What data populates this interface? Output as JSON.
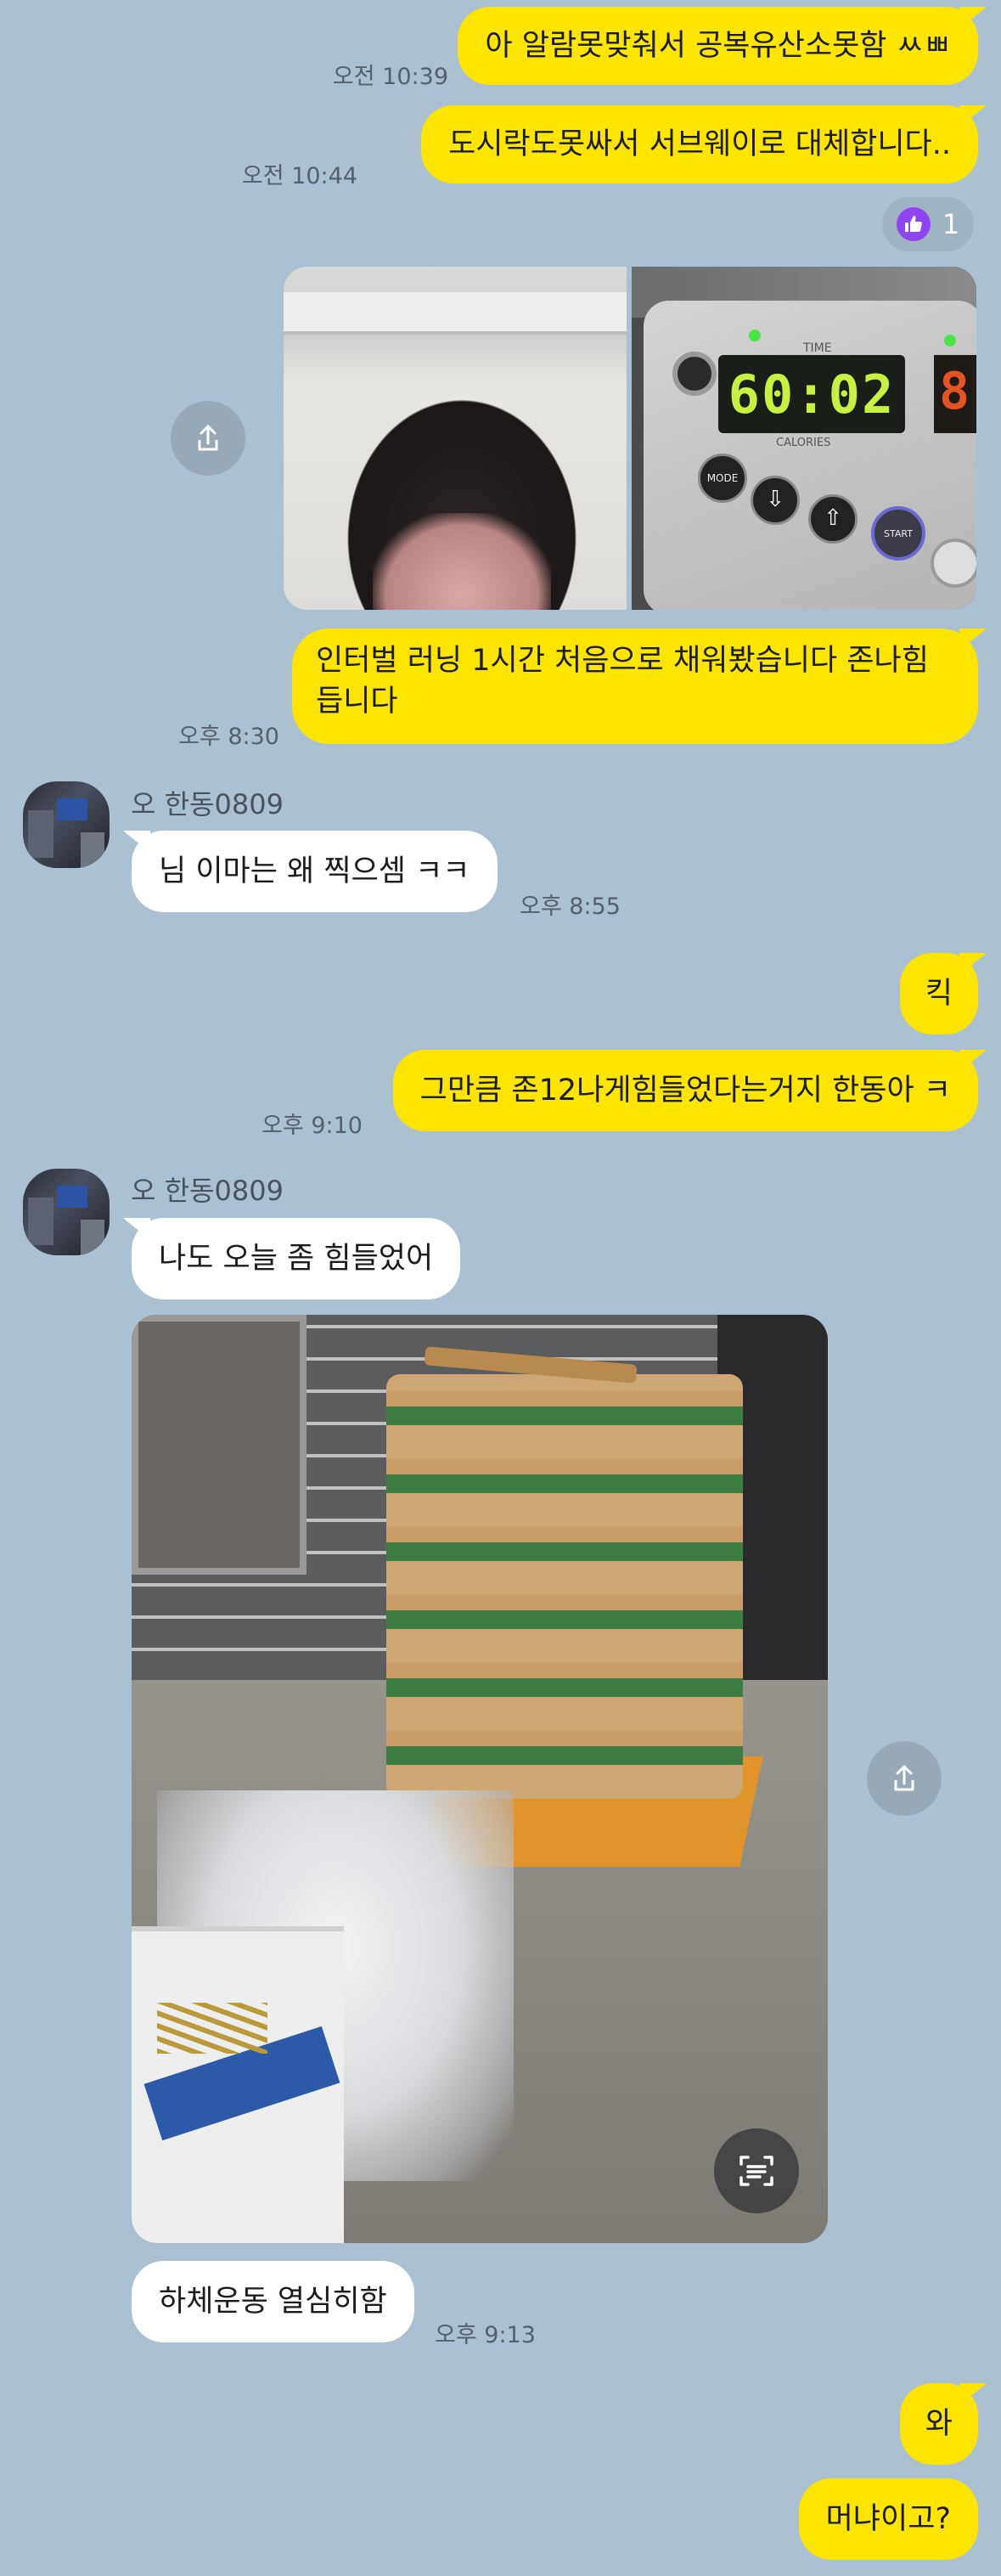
{
  "messages": {
    "m1": {
      "text": "아 알람못맞춰서 공복유산소못함 ㅆㅃ",
      "time": "오전 10:39"
    },
    "m2": {
      "text": "도시락도못싸서 서브웨이로 대체합니다..",
      "time": "오전 10:44"
    },
    "reaction": {
      "count": "1"
    },
    "m3": {
      "text": "인터벌 러닝 1시간 처음으로 채워봤습니다 존나힘듭니다",
      "time": "오후 8:30"
    },
    "m4": {
      "sender": "오 한동0809",
      "text": "님 이마는 왜 찍으셈 ㅋㅋ",
      "time": "오후 8:55"
    },
    "m5": {
      "text": "킥"
    },
    "m6": {
      "text": "그만큼 존12나게힘들었다는거지 한동아 ㅋ",
      "time": "오후 9:10"
    },
    "m7": {
      "sender": "오 한동0809",
      "text": "나도 오늘 좀 힘들었어"
    },
    "m8": {
      "text": "하체운동 열심히함",
      "time": "오후 9:13"
    },
    "m9": {
      "text": "와"
    },
    "m10": {
      "text": "머냐이고?"
    }
  },
  "treadmill_display": {
    "time": "60:02",
    "labels": {
      "time": "TIME",
      "calories": "CALORIES",
      "mode": "MODE",
      "start": "START"
    }
  },
  "colors": {
    "background": "#abc1d1",
    "my_bubble": "#fee500",
    "their_bubble": "#ffffff"
  }
}
